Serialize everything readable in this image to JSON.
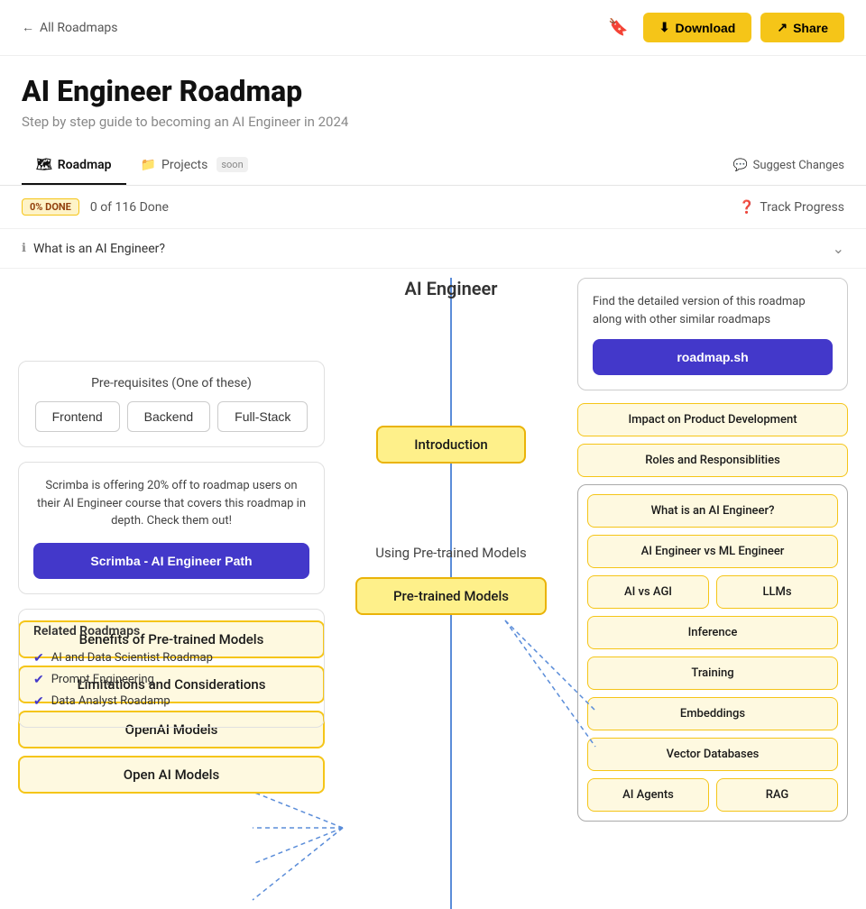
{
  "nav": {
    "back_label": "All Roadmaps",
    "bookmark_icon": "🔖",
    "download_label": "Download",
    "download_icon": "⬇",
    "share_label": "Share",
    "share_icon": "↗"
  },
  "header": {
    "title": "AI Engineer Roadmap",
    "subtitle": "Step by step guide to becoming an AI Engineer in 2024"
  },
  "tabs": [
    {
      "label": "Roadmap",
      "icon": "🗺",
      "active": true
    },
    {
      "label": "Projects",
      "icon": "📁",
      "active": false,
      "badge": "soon"
    }
  ],
  "suggest_changes": "Suggest Changes",
  "progress": {
    "badge": "0% DONE",
    "count": "0 of 116 Done",
    "track_label": "Track Progress",
    "track_icon": "?"
  },
  "faq": {
    "question": "What is an AI Engineer?"
  },
  "prereq_card": {
    "title": "Pre-requisites (One of these)",
    "buttons": [
      "Frontend",
      "Backend",
      "Full-Stack"
    ]
  },
  "promo_card": {
    "text": "Scrimba is offering 20% off to roadmap users on their AI Engineer course that covers this roadmap in depth. Check them out!",
    "button_label": "Scrimba - AI Engineer Path"
  },
  "related_card": {
    "title": "Related Roadmaps",
    "items": [
      "AI and Data Scientist Roadmap",
      "Prompt Engineering",
      "Data Analyst Roadamp"
    ]
  },
  "roadmap_sh_card": {
    "text": "Find the detailed version of this roadmap along with other similar roadmaps",
    "button_label": "roadmap.sh"
  },
  "diagram": {
    "main_title": "AI Engineer",
    "intro_node": "Introduction",
    "pretrained_section": "Using Pre-trained Models",
    "pretrained_node": "Pre-trained Models",
    "right_nodes_top": [
      "Impact on Product Development",
      "Roles and Responsiblities"
    ],
    "right_section_nodes": [
      {
        "type": "single",
        "label": "What is an AI Engineer?"
      },
      {
        "type": "single",
        "label": "AI Engineer vs ML Engineer"
      },
      {
        "type": "row",
        "labels": [
          "AI vs AGI",
          "LLMs"
        ]
      },
      {
        "type": "single",
        "label": "Inference"
      },
      {
        "type": "single",
        "label": "Training"
      },
      {
        "type": "single",
        "label": "Embeddings"
      },
      {
        "type": "single",
        "label": "Vector Databases"
      },
      {
        "type": "row",
        "labels": [
          "AI Agents",
          "RAG"
        ]
      }
    ],
    "left_bottom_nodes": [
      "Benefits of Pre-trained Models",
      "Limitations and Considerations",
      "OpenAI Models",
      "Open AI Models"
    ]
  }
}
